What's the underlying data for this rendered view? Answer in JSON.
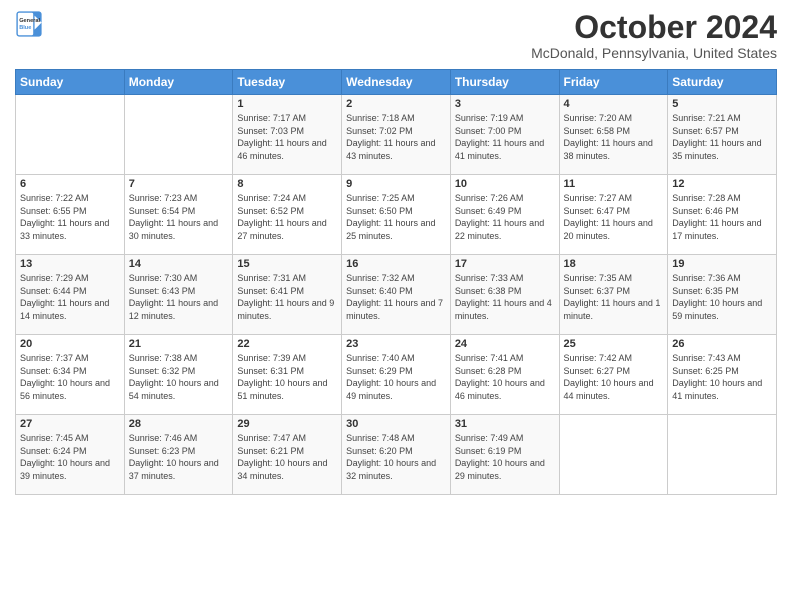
{
  "header": {
    "logo_line1": "General",
    "logo_line2": "Blue",
    "month_title": "October 2024",
    "location": "McDonald, Pennsylvania, United States"
  },
  "days_of_week": [
    "Sunday",
    "Monday",
    "Tuesday",
    "Wednesday",
    "Thursday",
    "Friday",
    "Saturday"
  ],
  "weeks": [
    [
      {
        "day": "",
        "info": ""
      },
      {
        "day": "",
        "info": ""
      },
      {
        "day": "1",
        "info": "Sunrise: 7:17 AM\nSunset: 7:03 PM\nDaylight: 11 hours and 46 minutes."
      },
      {
        "day": "2",
        "info": "Sunrise: 7:18 AM\nSunset: 7:02 PM\nDaylight: 11 hours and 43 minutes."
      },
      {
        "day": "3",
        "info": "Sunrise: 7:19 AM\nSunset: 7:00 PM\nDaylight: 11 hours and 41 minutes."
      },
      {
        "day": "4",
        "info": "Sunrise: 7:20 AM\nSunset: 6:58 PM\nDaylight: 11 hours and 38 minutes."
      },
      {
        "day": "5",
        "info": "Sunrise: 7:21 AM\nSunset: 6:57 PM\nDaylight: 11 hours and 35 minutes."
      }
    ],
    [
      {
        "day": "6",
        "info": "Sunrise: 7:22 AM\nSunset: 6:55 PM\nDaylight: 11 hours and 33 minutes."
      },
      {
        "day": "7",
        "info": "Sunrise: 7:23 AM\nSunset: 6:54 PM\nDaylight: 11 hours and 30 minutes."
      },
      {
        "day": "8",
        "info": "Sunrise: 7:24 AM\nSunset: 6:52 PM\nDaylight: 11 hours and 27 minutes."
      },
      {
        "day": "9",
        "info": "Sunrise: 7:25 AM\nSunset: 6:50 PM\nDaylight: 11 hours and 25 minutes."
      },
      {
        "day": "10",
        "info": "Sunrise: 7:26 AM\nSunset: 6:49 PM\nDaylight: 11 hours and 22 minutes."
      },
      {
        "day": "11",
        "info": "Sunrise: 7:27 AM\nSunset: 6:47 PM\nDaylight: 11 hours and 20 minutes."
      },
      {
        "day": "12",
        "info": "Sunrise: 7:28 AM\nSunset: 6:46 PM\nDaylight: 11 hours and 17 minutes."
      }
    ],
    [
      {
        "day": "13",
        "info": "Sunrise: 7:29 AM\nSunset: 6:44 PM\nDaylight: 11 hours and 14 minutes."
      },
      {
        "day": "14",
        "info": "Sunrise: 7:30 AM\nSunset: 6:43 PM\nDaylight: 11 hours and 12 minutes."
      },
      {
        "day": "15",
        "info": "Sunrise: 7:31 AM\nSunset: 6:41 PM\nDaylight: 11 hours and 9 minutes."
      },
      {
        "day": "16",
        "info": "Sunrise: 7:32 AM\nSunset: 6:40 PM\nDaylight: 11 hours and 7 minutes."
      },
      {
        "day": "17",
        "info": "Sunrise: 7:33 AM\nSunset: 6:38 PM\nDaylight: 11 hours and 4 minutes."
      },
      {
        "day": "18",
        "info": "Sunrise: 7:35 AM\nSunset: 6:37 PM\nDaylight: 11 hours and 1 minute."
      },
      {
        "day": "19",
        "info": "Sunrise: 7:36 AM\nSunset: 6:35 PM\nDaylight: 10 hours and 59 minutes."
      }
    ],
    [
      {
        "day": "20",
        "info": "Sunrise: 7:37 AM\nSunset: 6:34 PM\nDaylight: 10 hours and 56 minutes."
      },
      {
        "day": "21",
        "info": "Sunrise: 7:38 AM\nSunset: 6:32 PM\nDaylight: 10 hours and 54 minutes."
      },
      {
        "day": "22",
        "info": "Sunrise: 7:39 AM\nSunset: 6:31 PM\nDaylight: 10 hours and 51 minutes."
      },
      {
        "day": "23",
        "info": "Sunrise: 7:40 AM\nSunset: 6:29 PM\nDaylight: 10 hours and 49 minutes."
      },
      {
        "day": "24",
        "info": "Sunrise: 7:41 AM\nSunset: 6:28 PM\nDaylight: 10 hours and 46 minutes."
      },
      {
        "day": "25",
        "info": "Sunrise: 7:42 AM\nSunset: 6:27 PM\nDaylight: 10 hours and 44 minutes."
      },
      {
        "day": "26",
        "info": "Sunrise: 7:43 AM\nSunset: 6:25 PM\nDaylight: 10 hours and 41 minutes."
      }
    ],
    [
      {
        "day": "27",
        "info": "Sunrise: 7:45 AM\nSunset: 6:24 PM\nDaylight: 10 hours and 39 minutes."
      },
      {
        "day": "28",
        "info": "Sunrise: 7:46 AM\nSunset: 6:23 PM\nDaylight: 10 hours and 37 minutes."
      },
      {
        "day": "29",
        "info": "Sunrise: 7:47 AM\nSunset: 6:21 PM\nDaylight: 10 hours and 34 minutes."
      },
      {
        "day": "30",
        "info": "Sunrise: 7:48 AM\nSunset: 6:20 PM\nDaylight: 10 hours and 32 minutes."
      },
      {
        "day": "31",
        "info": "Sunrise: 7:49 AM\nSunset: 6:19 PM\nDaylight: 10 hours and 29 minutes."
      },
      {
        "day": "",
        "info": ""
      },
      {
        "day": "",
        "info": ""
      }
    ]
  ]
}
